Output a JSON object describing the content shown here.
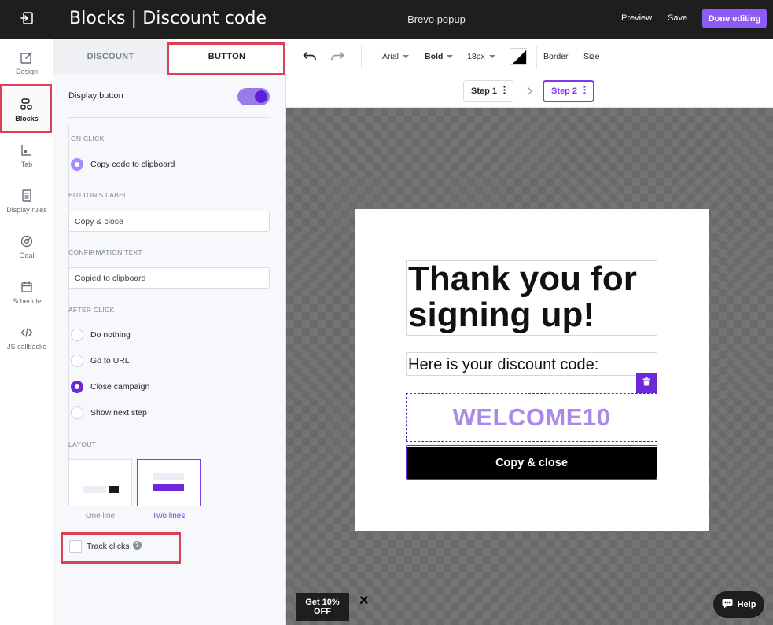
{
  "header": {
    "title": "Blocks | Discount code",
    "campaign_name": "Brevo popup",
    "preview_label": "Preview",
    "save_label": "Save",
    "done_label": "Done editing"
  },
  "rail": {
    "items": [
      {
        "label": "Design",
        "icon": "design-icon"
      },
      {
        "label": "Blocks",
        "icon": "blocks-icon"
      },
      {
        "label": "Tab",
        "icon": "tab-icon"
      },
      {
        "label": "Display rules",
        "icon": "display-rules-icon"
      },
      {
        "label": "Goal",
        "icon": "goal-icon"
      },
      {
        "label": "Schedule",
        "icon": "schedule-icon"
      },
      {
        "label": "JS callbacks",
        "icon": "code-icon"
      }
    ],
    "active": "Blocks"
  },
  "panel": {
    "tabs": [
      "DISCOUNT",
      "BUTTON"
    ],
    "active_tab": "BUTTON",
    "display_button_label": "Display button",
    "display_button_on": true,
    "on_click": {
      "heading": "ON CLICK",
      "option": "Copy code to clipboard"
    },
    "button_label": {
      "heading": "BUTTON'S LABEL",
      "value": "Copy & close"
    },
    "confirmation": {
      "heading": "CONFIRMATION TEXT",
      "value": "Copied to clipboard"
    },
    "after_click": {
      "heading": "AFTER CLICK",
      "options": [
        "Do nothing",
        "Go to URL",
        "Close campaign",
        "Show next step"
      ],
      "selected": "Close campaign"
    },
    "layout": {
      "heading": "LAYOUT",
      "options": [
        "One line",
        "Two lines"
      ],
      "selected": "Two lines"
    },
    "track_clicks_label": "Track clicks",
    "track_clicks_checked": false
  },
  "toolbar": {
    "font": "Arial",
    "weight": "Bold",
    "size": "18px",
    "border_label": "Border",
    "size_label": "Size"
  },
  "steps": {
    "items": [
      "Step 1",
      "Step 2"
    ],
    "active": "Step 2"
  },
  "popup": {
    "headline": "Thank you for signing up!",
    "subline": "Here is your discount code:",
    "code": "WELCOME10",
    "button": "Copy & close"
  },
  "teaser": {
    "label": "Get 10% OFF"
  },
  "help": {
    "label": "Help"
  },
  "colors": {
    "accent": "#7c3aed",
    "highlight_box": "#d94154",
    "topbar": "#1e1e1e",
    "code_text": "#a98ae8"
  }
}
